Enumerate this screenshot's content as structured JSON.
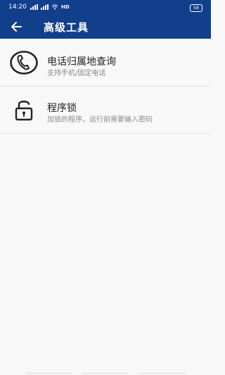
{
  "status_bar": {
    "time": "14:20",
    "network": "HD",
    "battery": "58"
  },
  "header": {
    "title": "高级工具"
  },
  "items": [
    {
      "title": "电话归属地查询",
      "subtitle": "支持手机/固定电话",
      "icon": "phone-icon"
    },
    {
      "title": "程序锁",
      "subtitle": "加锁的程序，运行前需要输入密码",
      "icon": "lock-icon"
    }
  ],
  "colors": {
    "primary": "#123f8c",
    "background": "#f8f8f8",
    "title_text": "#222222",
    "subtitle_text": "#8a8a8a"
  }
}
